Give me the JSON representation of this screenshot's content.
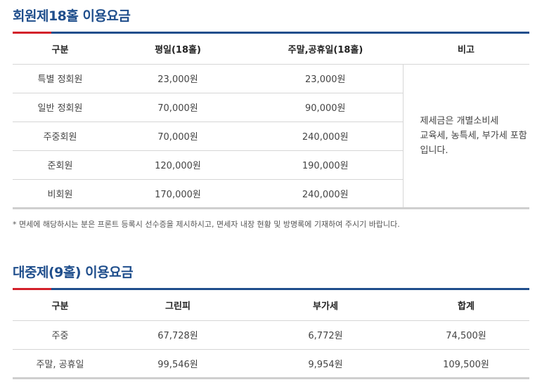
{
  "member_section": {
    "title": "회원제18홀 이용요금",
    "headers": [
      "구분",
      "평일(18홀)",
      "주말,공휴일(18홀)",
      "비고"
    ],
    "rows": [
      [
        "특별 정회원",
        "23,000원",
        "23,000원"
      ],
      [
        "일반 정회원",
        "70,000원",
        "90,000원"
      ],
      [
        "주중회원",
        "70,000원",
        "240,000원"
      ],
      [
        "준회원",
        "120,000원",
        "190,000원"
      ],
      [
        "비회원",
        "170,000원",
        "240,000원"
      ]
    ],
    "note_lines": [
      "제세금은 개별소비세",
      "교육세, 농특세, 부가세 포함",
      "입니다."
    ],
    "footnote": "* 면세에 해당하시는 분은 프론트 등록시 선수증을 제시하시고, 면세자 내장 현황 및 방명록에 기재하여 주시기 바랍니다."
  },
  "public_section": {
    "title": "대중제(9홀) 이용요금",
    "headers": [
      "구분",
      "그린피",
      "부가세",
      "합계"
    ],
    "rows": [
      [
        "주중",
        "67,728원",
        "6,772원",
        "74,500원"
      ],
      [
        "주말, 공휴일",
        "99,546원",
        "9,954원",
        "109,500원"
      ]
    ]
  },
  "colors": {
    "title": "#1f4e8c",
    "accent": "#d3202a"
  }
}
